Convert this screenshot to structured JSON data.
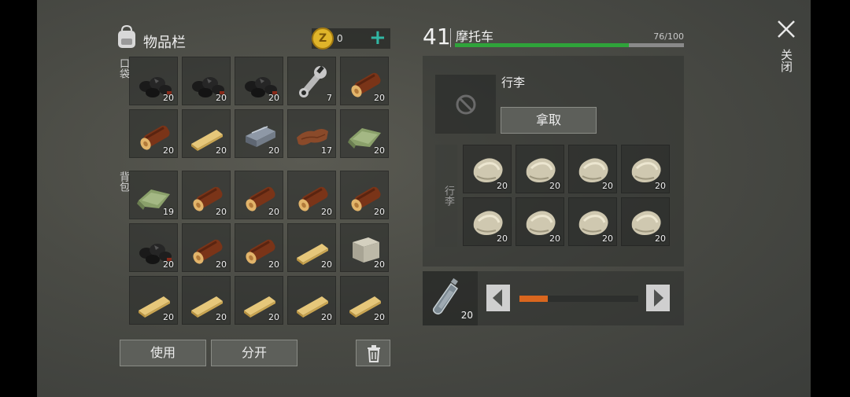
{
  "inventory": {
    "title": "物品栏",
    "coins": "0",
    "pocket_label": "口袋",
    "backpack_label": "背包",
    "pocket": [
      {
        "icon": "coal-icon",
        "count": "20"
      },
      {
        "icon": "coal-icon",
        "count": "20"
      },
      {
        "icon": "coal-icon",
        "count": "20"
      },
      {
        "icon": "wrench-icon",
        "count": "7"
      },
      {
        "icon": "log-icon",
        "count": "20"
      },
      {
        "icon": "log-icon",
        "count": "20"
      },
      {
        "icon": "plank-icon",
        "count": "20"
      },
      {
        "icon": "iron-ingot-icon",
        "count": "20"
      },
      {
        "icon": "leather-icon",
        "count": "17"
      },
      {
        "icon": "cloth-icon",
        "count": "20"
      }
    ],
    "backpack": [
      {
        "icon": "cloth-icon",
        "count": "19"
      },
      {
        "icon": "log-icon",
        "count": "20"
      },
      {
        "icon": "log-icon",
        "count": "20"
      },
      {
        "icon": "log-icon",
        "count": "20"
      },
      {
        "icon": "log-icon",
        "count": "20"
      },
      {
        "icon": "coal-icon",
        "count": "20"
      },
      {
        "icon": "log-icon",
        "count": "20"
      },
      {
        "icon": "log-icon",
        "count": "20"
      },
      {
        "icon": "plank-icon",
        "count": "20"
      },
      {
        "icon": "stone-block-icon",
        "count": "20"
      },
      {
        "icon": "plank-icon",
        "count": "20"
      },
      {
        "icon": "plank-icon",
        "count": "20"
      },
      {
        "icon": "plank-icon",
        "count": "20"
      },
      {
        "icon": "plank-icon",
        "count": "20"
      },
      {
        "icon": "plank-icon",
        "count": "20"
      }
    ],
    "use_label": "使用",
    "split_label": "分开"
  },
  "vehicle": {
    "level": "41",
    "name": "摩托车",
    "durability_text": "76/100",
    "durability_fraction": 0.76,
    "luggage_title": "行李",
    "take_label": "拿取",
    "luggage_side_label": "行李",
    "luggage_items": [
      {
        "icon": "stone-icon",
        "count": "20"
      },
      {
        "icon": "stone-icon",
        "count": "20"
      },
      {
        "icon": "stone-icon",
        "count": "20"
      },
      {
        "icon": "stone-icon",
        "count": "20"
      },
      {
        "icon": "stone-icon",
        "count": "20"
      },
      {
        "icon": "stone-icon",
        "count": "20"
      },
      {
        "icon": "stone-icon",
        "count": "20"
      },
      {
        "icon": "stone-icon",
        "count": "20"
      }
    ],
    "fuel_item": {
      "icon": "fuel-bottle-icon",
      "count": "20"
    },
    "fuel_fraction": 0.24
  },
  "close_label": "关闭",
  "colors": {
    "accent_green": "#2fa33a",
    "coin": "#e0b52a",
    "plus": "#31b7a4",
    "fuel": "#d9661e"
  }
}
